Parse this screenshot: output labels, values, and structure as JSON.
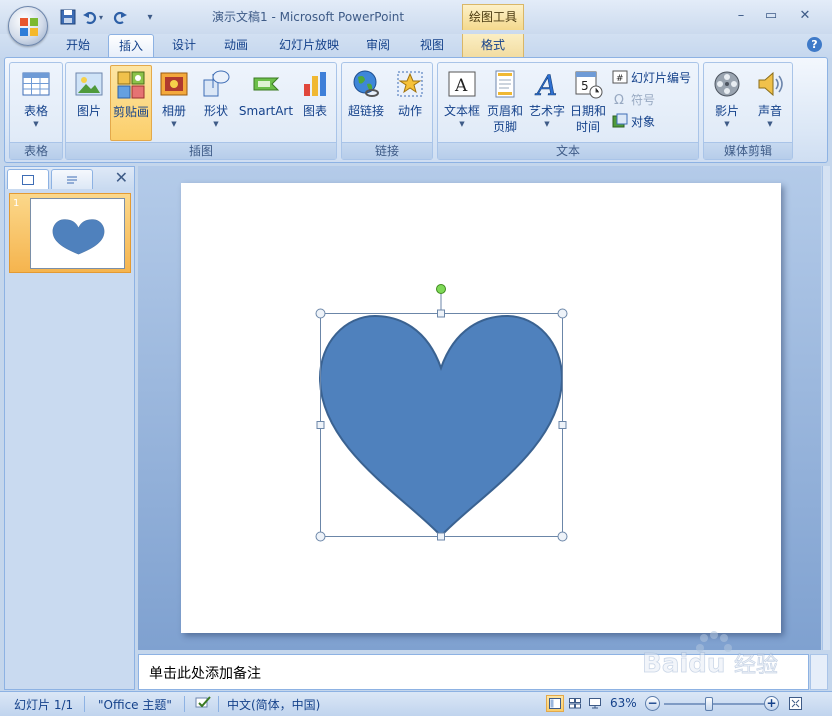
{
  "app": {
    "window_title": "演示文稿1 - Microsoft PowerPoint",
    "contextual_header": "绘图工具",
    "minimize": "–",
    "maximize": "▭",
    "close": "✕"
  },
  "tabs": [
    {
      "label": "开始"
    },
    {
      "label": "插入",
      "active": true
    },
    {
      "label": "设计"
    },
    {
      "label": "动画"
    },
    {
      "label": "幻灯片放映"
    },
    {
      "label": "审阅"
    },
    {
      "label": "视图"
    },
    {
      "label": "格式",
      "contextual": true
    }
  ],
  "help_label": "?",
  "ribbon": {
    "groups": {
      "tables": {
        "label": "表格",
        "table_button": "表格"
      },
      "illustrations": {
        "label": "插图",
        "picture": "图片",
        "clipart": "剪贴画",
        "album": "相册",
        "shapes": "形状",
        "smartart": "SmartArt",
        "chart": "图表"
      },
      "links": {
        "label": "链接",
        "hyperlink": "超链接",
        "action": "动作"
      },
      "text": {
        "label": "文本",
        "textbox": "文本框",
        "header_footer_1": "页眉和",
        "header_footer_2": "页脚",
        "wordart": "艺术字",
        "datetime_1": "日期和",
        "datetime_2": "时间",
        "slide_number": "幻灯片编号",
        "symbol": "符号",
        "object": "对象"
      },
      "media": {
        "label": "媒体剪辑",
        "movie": "影片",
        "sound": "声音"
      }
    }
  },
  "slides_pane": {
    "close": "✕",
    "thumbnail_number": "1"
  },
  "notes": {
    "placeholder": "单击此处添加备注"
  },
  "status": {
    "slide_info": "幻灯片 1/1",
    "theme": "\"Office 主题\"",
    "language": "中文(简体，中国)",
    "zoom": "63%",
    "zoom_level": 0.45
  },
  "colors": {
    "heart_fill": "#4f81bd",
    "heart_stroke": "#3a6291",
    "handle_rotate": "#7ed957"
  },
  "watermark": {
    "brand": "Baidu",
    "tail": "经验"
  }
}
